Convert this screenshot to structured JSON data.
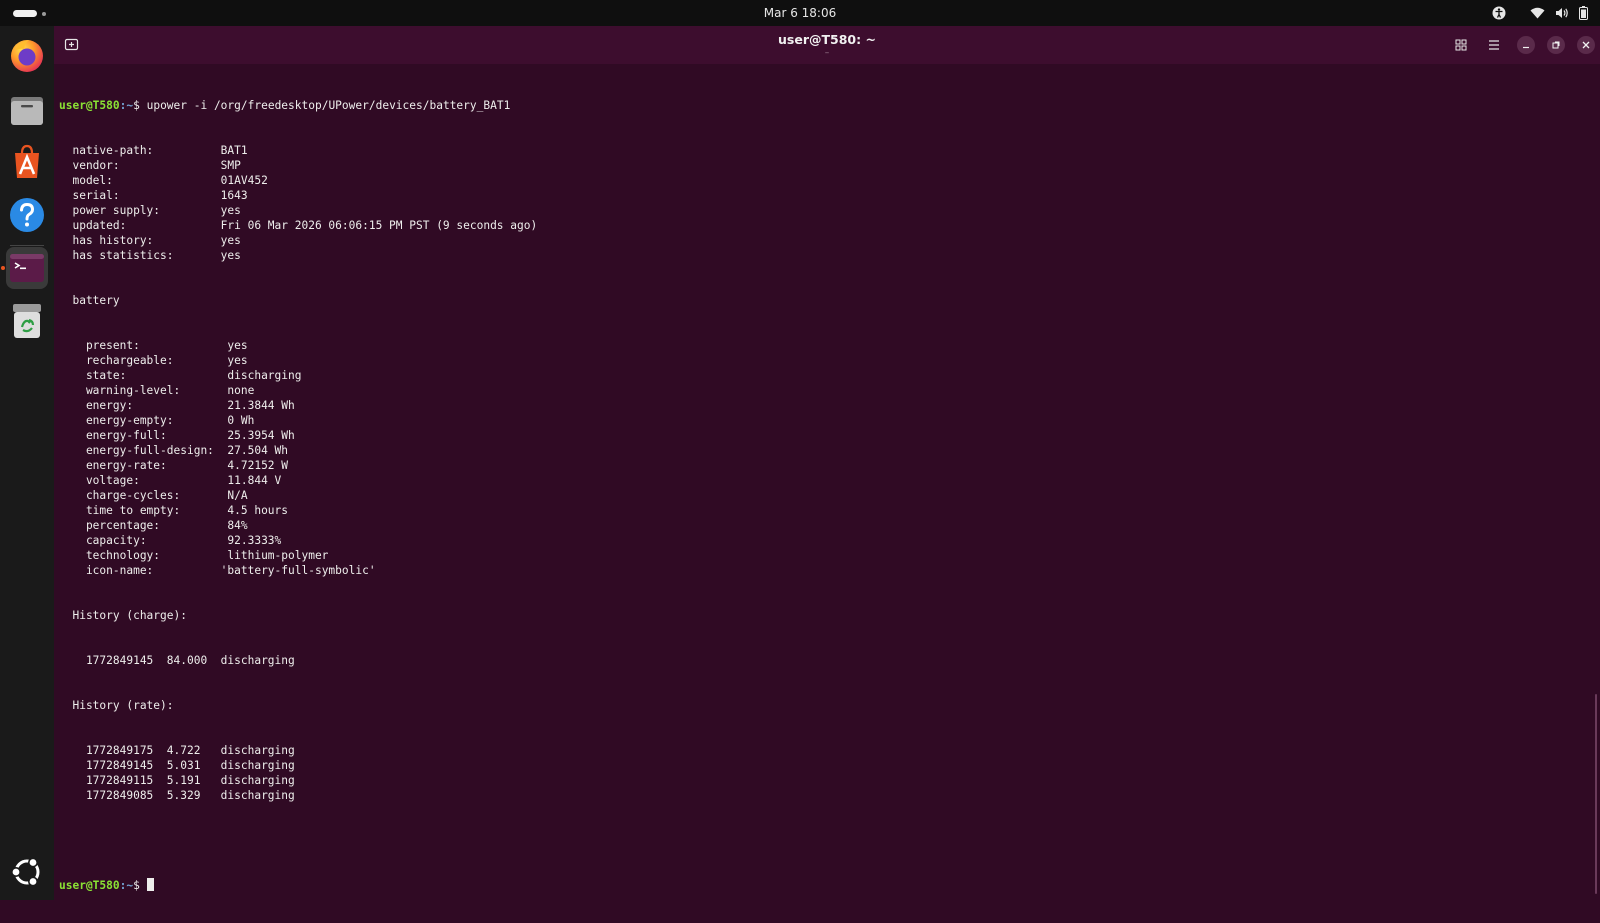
{
  "topbar": {
    "clock": "Mar 6  18:06",
    "tray_icons": [
      "accessibility-icon",
      "wifi-icon",
      "volume-icon",
      "battery-icon"
    ]
  },
  "dock": {
    "apps": [
      {
        "name": "firefox-icon",
        "running": false
      },
      {
        "name": "files-icon",
        "running": false
      },
      {
        "name": "app-center-icon",
        "running": false
      },
      {
        "name": "help-icon",
        "running": false
      },
      {
        "name": "terminal-icon",
        "running": true
      },
      {
        "name": "trash-icon",
        "running": false
      }
    ],
    "show_apps": "ubuntu-show-apps-icon"
  },
  "window": {
    "title": "user@T580: ~",
    "subtitle": "–"
  },
  "terminal": {
    "prompt_user": "user@T580",
    "prompt_path": ":~",
    "prompt_sign": "$ ",
    "command": "upower -i /org/freedesktop/UPower/devices/battery_BAT1",
    "device": [
      {
        "k": "  native-path:          ",
        "v": "BAT1"
      },
      {
        "k": "  vendor:               ",
        "v": "SMP"
      },
      {
        "k": "  model:                ",
        "v": "01AV452"
      },
      {
        "k": "  serial:               ",
        "v": "1643"
      },
      {
        "k": "  power supply:         ",
        "v": "yes"
      },
      {
        "k": "  updated:              ",
        "v": "Fri 06 Mar 2026 06:06:15 PM PST (9 seconds ago)"
      },
      {
        "k": "  has history:          ",
        "v": "yes"
      },
      {
        "k": "  has statistics:       ",
        "v": "yes"
      }
    ],
    "battery_header": "  battery",
    "battery": [
      {
        "k": "    present:             ",
        "v": "yes"
      },
      {
        "k": "    rechargeable:        ",
        "v": "yes"
      },
      {
        "k": "    state:               ",
        "v": "discharging"
      },
      {
        "k": "    warning-level:       ",
        "v": "none"
      },
      {
        "k": "    energy:              ",
        "v": "21.3844 Wh"
      },
      {
        "k": "    energy-empty:        ",
        "v": "0 Wh"
      },
      {
        "k": "    energy-full:         ",
        "v": "25.3954 Wh"
      },
      {
        "k": "    energy-full-design:  ",
        "v": "27.504 Wh"
      },
      {
        "k": "    energy-rate:         ",
        "v": "4.72152 W"
      },
      {
        "k": "    voltage:             ",
        "v": "11.844 V"
      },
      {
        "k": "    charge-cycles:       ",
        "v": "N/A"
      },
      {
        "k": "    time to empty:       ",
        "v": "4.5 hours"
      },
      {
        "k": "    percentage:          ",
        "v": "84%"
      },
      {
        "k": "    capacity:            ",
        "v": "92.3333%"
      },
      {
        "k": "    technology:          ",
        "v": "lithium-polymer"
      },
      {
        "k": "    icon-name:          ",
        "v": "'battery-full-symbolic'"
      }
    ],
    "history_charge_header": "  History (charge):",
    "history_charge": [
      "    1772849145  84.000  discharging"
    ],
    "history_rate_header": "  History (rate):",
    "history_rate": [
      "    1772849175  4.722   discharging",
      "    1772849145  5.031   discharging",
      "    1772849115  5.191   discharging",
      "    1772849085  5.329   discharging"
    ]
  }
}
